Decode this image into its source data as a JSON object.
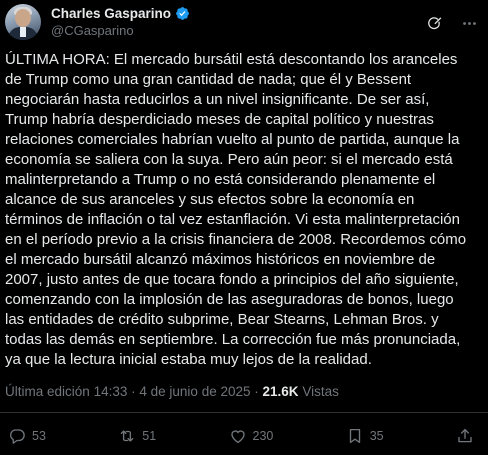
{
  "author": {
    "display_name": "Charles Gasparino",
    "handle": "@CGasparino",
    "verified": true
  },
  "icons": {
    "verified": "verified-badge-icon",
    "grok": "grok-icon",
    "more": "more-icon",
    "reply": "reply-icon",
    "retweet": "retweet-icon",
    "like": "like-icon",
    "bookmark": "bookmark-icon",
    "share": "share-icon"
  },
  "tweet": {
    "text": "ÚLTIMA HORA: El mercado bursátil está descontando los aranceles de Trump como una gran cantidad de nada; que él y Bessent negociarán hasta reducirlos a un nivel insignificante. De ser así, Trump habría desperdiciado meses de capital político y nuestras relaciones comerciales habrían vuelto al punto de partida, aunque la economía se saliera con la suya. Pero aún peor: si el mercado está malinterpretando a Trump o no está considerando plenamente el alcance de sus aranceles y sus efectos sobre la economía en términos de inflación o tal vez estanflación. Vi esta malinterpretación en el período previo a la crisis financiera de 2008. Recordemos cómo el mercado bursátil alcanzó máximos históricos en noviembre de 2007, justo antes de que tocara fondo a principios del año siguiente, comenzando con la implosión de las aseguradoras de bonos, luego las entidades de crédito subprime, Bear Stearns, Lehman Bros. y todas las demás en septiembre. La corrección fue más pronunciada, ya que la lectura inicial estaba muy lejos de la realidad.",
    "edited_label": "Última edición",
    "time": "14:33",
    "separator": "·",
    "date": "4 de junio de 2025",
    "views_count": "21.6K",
    "views_label": "Vistas"
  },
  "actions": {
    "replies": "53",
    "retweets": "51",
    "likes": "230",
    "bookmarks": "35"
  },
  "colors": {
    "background": "#000000",
    "text": "#e7e9ea",
    "secondary": "#71767b",
    "verified": "#1d9bf0",
    "divider": "#2f3336"
  }
}
